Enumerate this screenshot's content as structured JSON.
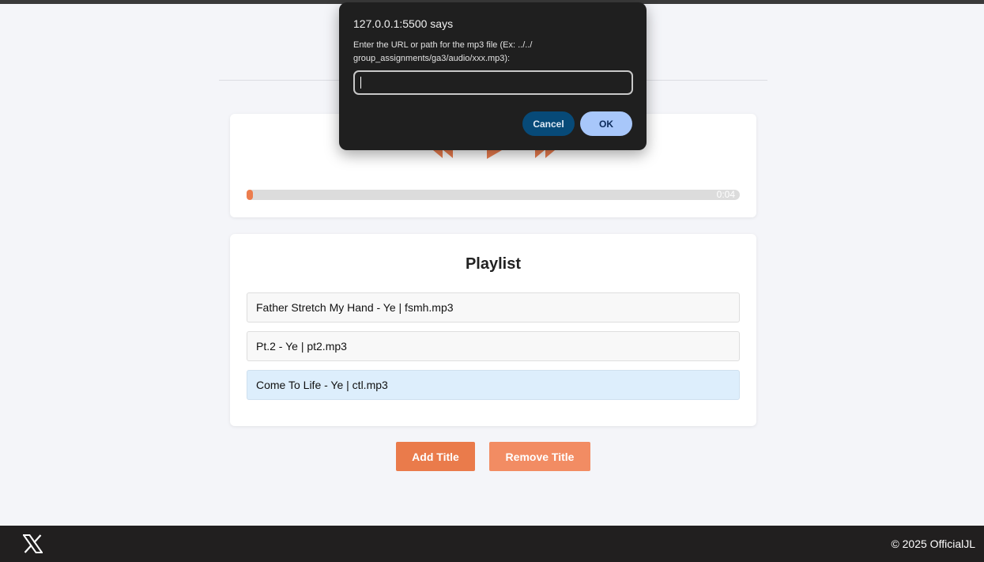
{
  "player": {
    "progress_fraction": 0.012,
    "time_display": "0:04",
    "controls": {
      "prev_icon": "rewind-icon",
      "play_icon": "play-icon",
      "next_icon": "fast-forward-icon"
    },
    "accent_color": "#ec7d4e"
  },
  "playlist": {
    "title": "Playlist",
    "items": [
      {
        "label": "Father Stretch My Hand - Ye | fsmh.mp3",
        "active": false
      },
      {
        "label": "Pt.2 - Ye | pt2.mp3",
        "active": false
      },
      {
        "label": "Come To Life - Ye | ctl.mp3",
        "active": true
      }
    ]
  },
  "actions": {
    "add_label": "Add Title",
    "remove_label": "Remove Title"
  },
  "footer": {
    "logo_icon": "x-logo-icon",
    "copyright": "© 2025 OfficialJL"
  },
  "dialog": {
    "title": "127.0.0.1:5500 says",
    "message": "Enter the URL or path for the mp3 file (Ex: ../../ group_assignments/ga3/audio/xxx.mp3):",
    "input_value": "",
    "cancel_label": "Cancel",
    "ok_label": "OK"
  }
}
